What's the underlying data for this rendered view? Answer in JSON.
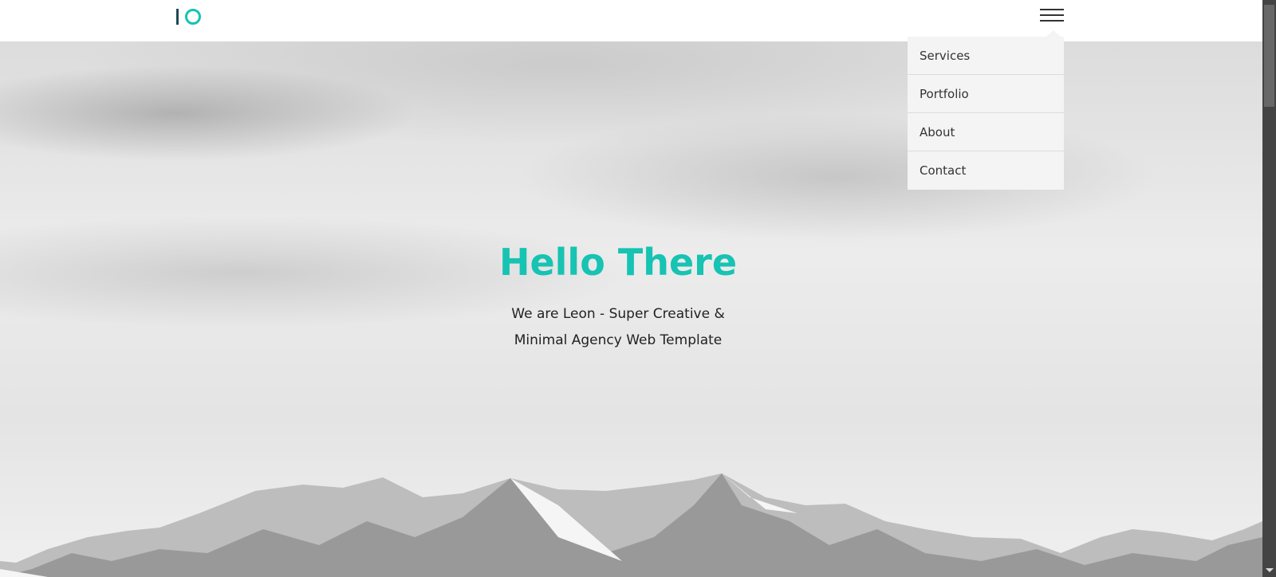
{
  "header": {
    "logo": "IO",
    "menu_items": [
      "Services",
      "Portfolio",
      "About",
      "Contact"
    ]
  },
  "hero": {
    "title": "Hello There",
    "subtitle_line1": "We are Leon - Super Creative &",
    "subtitle_line2": "Minimal Agency Web Template"
  },
  "colors": {
    "accent": "#17c3b2",
    "logo_bar": "#1e4a55"
  }
}
